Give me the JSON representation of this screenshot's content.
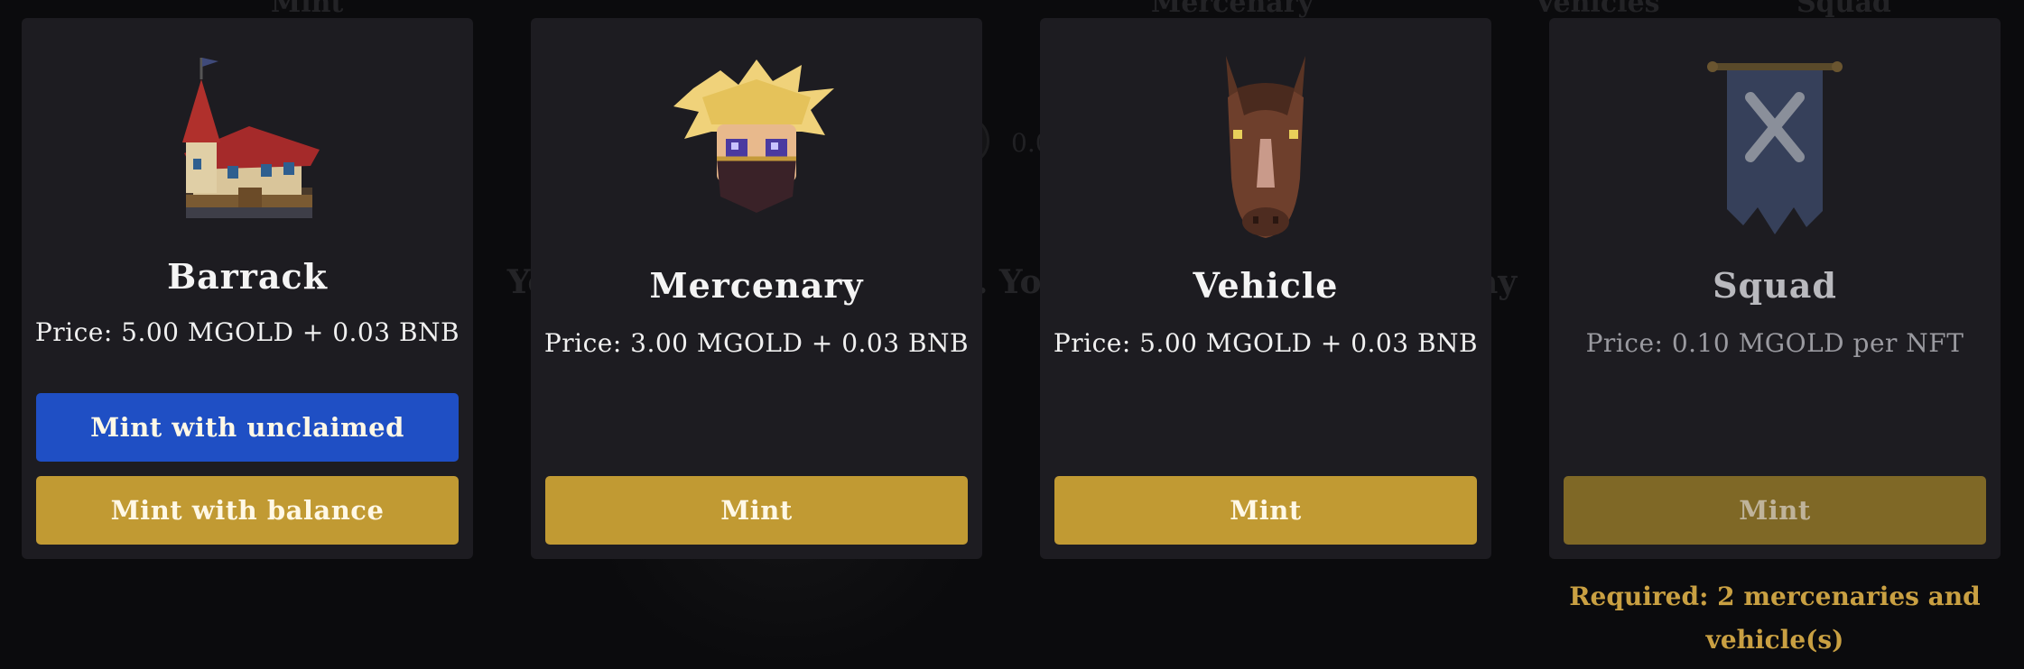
{
  "background": {
    "nav": [
      "Mint",
      "Mercenary",
      "Vehicles",
      "Squad"
    ],
    "balance": "0.0",
    "message": "You don't have squads yet. You have to mint one to play"
  },
  "cards": [
    {
      "title": "Barrack",
      "price": "Price: 5.00 MGOLD + 0.03 BNB",
      "buttons": [
        "Mint with unclaimed",
        "Mint with balance"
      ]
    },
    {
      "title": "Mercenary",
      "price": "Price: 3.00 MGOLD + 0.03 BNB",
      "buttons": [
        "Mint"
      ]
    },
    {
      "title": "Vehicle",
      "price": "Price: 5.00 MGOLD + 0.03 BNB",
      "buttons": [
        "Mint"
      ]
    },
    {
      "title": "Squad",
      "price": "Price: 0.10 MGOLD per NFT",
      "buttons": [
        "Mint"
      ],
      "requirement": "Required: 2 mercenaries and vehicle(s)"
    }
  ],
  "colors": {
    "card_bg": "#1d1c21",
    "primary_blue": "#1f4fc4",
    "gold": "#c19a33",
    "gold_disabled": "#7f6826",
    "requirement_text": "#c9a042"
  }
}
